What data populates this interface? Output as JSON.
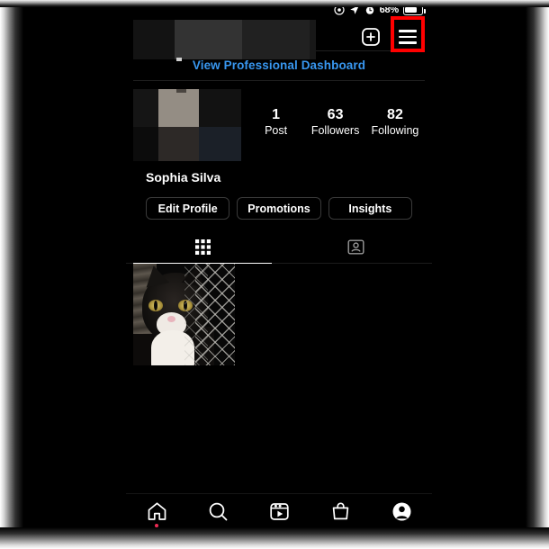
{
  "status_bar": {
    "icons": [
      "focus-circle-icon",
      "location-arrow-icon",
      "alarm-clock-icon"
    ],
    "battery_percent": "68%",
    "battery_icon": "battery-icon"
  },
  "top_bar": {
    "add_icon": "plus-square-icon",
    "menu_icon": "hamburger-menu-icon",
    "menu_highlight_color": "#ff0000",
    "username_area": "censored-username-banner"
  },
  "professional": {
    "dashboard_link": "View Professional Dashboard",
    "link_color": "#3897f0"
  },
  "profile": {
    "avatar": "censored-profile-picture",
    "display_name": "Sophia Silva",
    "stats": [
      {
        "num": "1",
        "label": "Post"
      },
      {
        "num": "63",
        "label": "Followers"
      },
      {
        "num": "82",
        "label": "Following"
      }
    ],
    "buttons": [
      {
        "label": "Edit Profile"
      },
      {
        "label": "Promotions"
      },
      {
        "label": "Insights"
      }
    ]
  },
  "tabs": [
    {
      "name": "grid-tab",
      "icon": "grid-icon",
      "active": true
    },
    {
      "name": "tagged-tab",
      "icon": "tagged-person-icon",
      "active": false
    }
  ],
  "posts": [
    {
      "alt": "black-and-white-cat-behind-chain-link-fence"
    }
  ],
  "bottom_nav": [
    {
      "name": "home",
      "icon": "home-icon",
      "badge": true,
      "active": false
    },
    {
      "name": "search",
      "icon": "search-icon",
      "badge": false,
      "active": false
    },
    {
      "name": "reels",
      "icon": "reels-icon",
      "badge": false,
      "active": false
    },
    {
      "name": "shop",
      "icon": "shop-bag-icon",
      "badge": false,
      "active": false
    },
    {
      "name": "profile",
      "icon": "profile-avatar-icon",
      "badge": false,
      "active": true
    }
  ]
}
